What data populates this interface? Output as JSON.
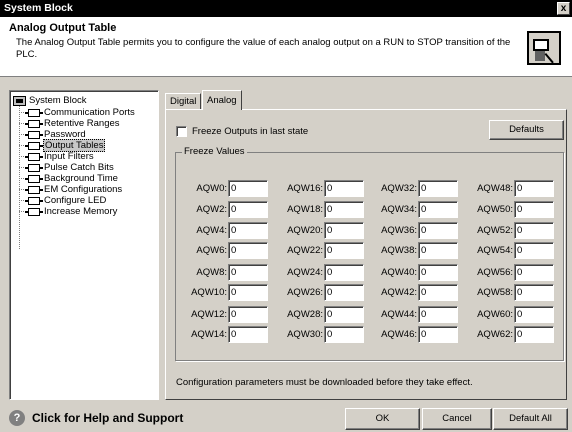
{
  "window": {
    "title": "System Block",
    "close_glyph": "x"
  },
  "header": {
    "title": "Analog Output Table",
    "description": "The Analog Output Table permits you to configure the value of each analog output on a RUN to STOP transition of the PLC.",
    "icon": "output-table-icon"
  },
  "tree": {
    "root": "System Block",
    "items": [
      "Communication Ports",
      "Retentive Ranges",
      "Password",
      "Output Tables",
      "Input Filters",
      "Pulse Catch Bits",
      "Background Time",
      "EM Configurations",
      "Configure LED",
      "Increase Memory"
    ],
    "selected_index": 3
  },
  "tabs": {
    "digital": "Digital",
    "analog": "Analog",
    "active": "Analog"
  },
  "freeze": {
    "checkbox_label": "Freeze Outputs in last state",
    "checked": false,
    "defaults_button": "Defaults",
    "group_label": "Freeze Values"
  },
  "fields": {
    "columns": [
      [
        {
          "label": "AQW0:",
          "value": "0"
        },
        {
          "label": "AQW2:",
          "value": "0"
        },
        {
          "label": "AQW4:",
          "value": "0"
        },
        {
          "label": "AQW6:",
          "value": "0"
        },
        {
          "label": "AQW8:",
          "value": "0"
        },
        {
          "label": "AQW10:",
          "value": "0"
        },
        {
          "label": "AQW12:",
          "value": "0"
        },
        {
          "label": "AQW14:",
          "value": "0"
        }
      ],
      [
        {
          "label": "AQW16:",
          "value": "0"
        },
        {
          "label": "AQW18:",
          "value": "0"
        },
        {
          "label": "AQW20:",
          "value": "0"
        },
        {
          "label": "AQW22:",
          "value": "0"
        },
        {
          "label": "AQW24:",
          "value": "0"
        },
        {
          "label": "AQW26:",
          "value": "0"
        },
        {
          "label": "AQW28:",
          "value": "0"
        },
        {
          "label": "AQW30:",
          "value": "0"
        }
      ],
      [
        {
          "label": "AQW32:",
          "value": "0"
        },
        {
          "label": "AQW34:",
          "value": "0"
        },
        {
          "label": "AQW36:",
          "value": "0"
        },
        {
          "label": "AQW38:",
          "value": "0"
        },
        {
          "label": "AQW40:",
          "value": "0"
        },
        {
          "label": "AQW42:",
          "value": "0"
        },
        {
          "label": "AQW44:",
          "value": "0"
        },
        {
          "label": "AQW46:",
          "value": "0"
        }
      ],
      [
        {
          "label": "AQW48:",
          "value": "0"
        },
        {
          "label": "AQW50:",
          "value": "0"
        },
        {
          "label": "AQW52:",
          "value": "0"
        },
        {
          "label": "AQW54:",
          "value": "0"
        },
        {
          "label": "AQW56:",
          "value": "0"
        },
        {
          "label": "AQW58:",
          "value": "0"
        },
        {
          "label": "AQW60:",
          "value": "0"
        },
        {
          "label": "AQW62:",
          "value": "0"
        }
      ]
    ]
  },
  "note": "Configuration parameters must be downloaded before they take effect.",
  "footer": {
    "help_text": "Click for Help and Support",
    "help_icon": "question-icon",
    "ok": "OK",
    "cancel": "Cancel",
    "default_all": "Default All"
  }
}
